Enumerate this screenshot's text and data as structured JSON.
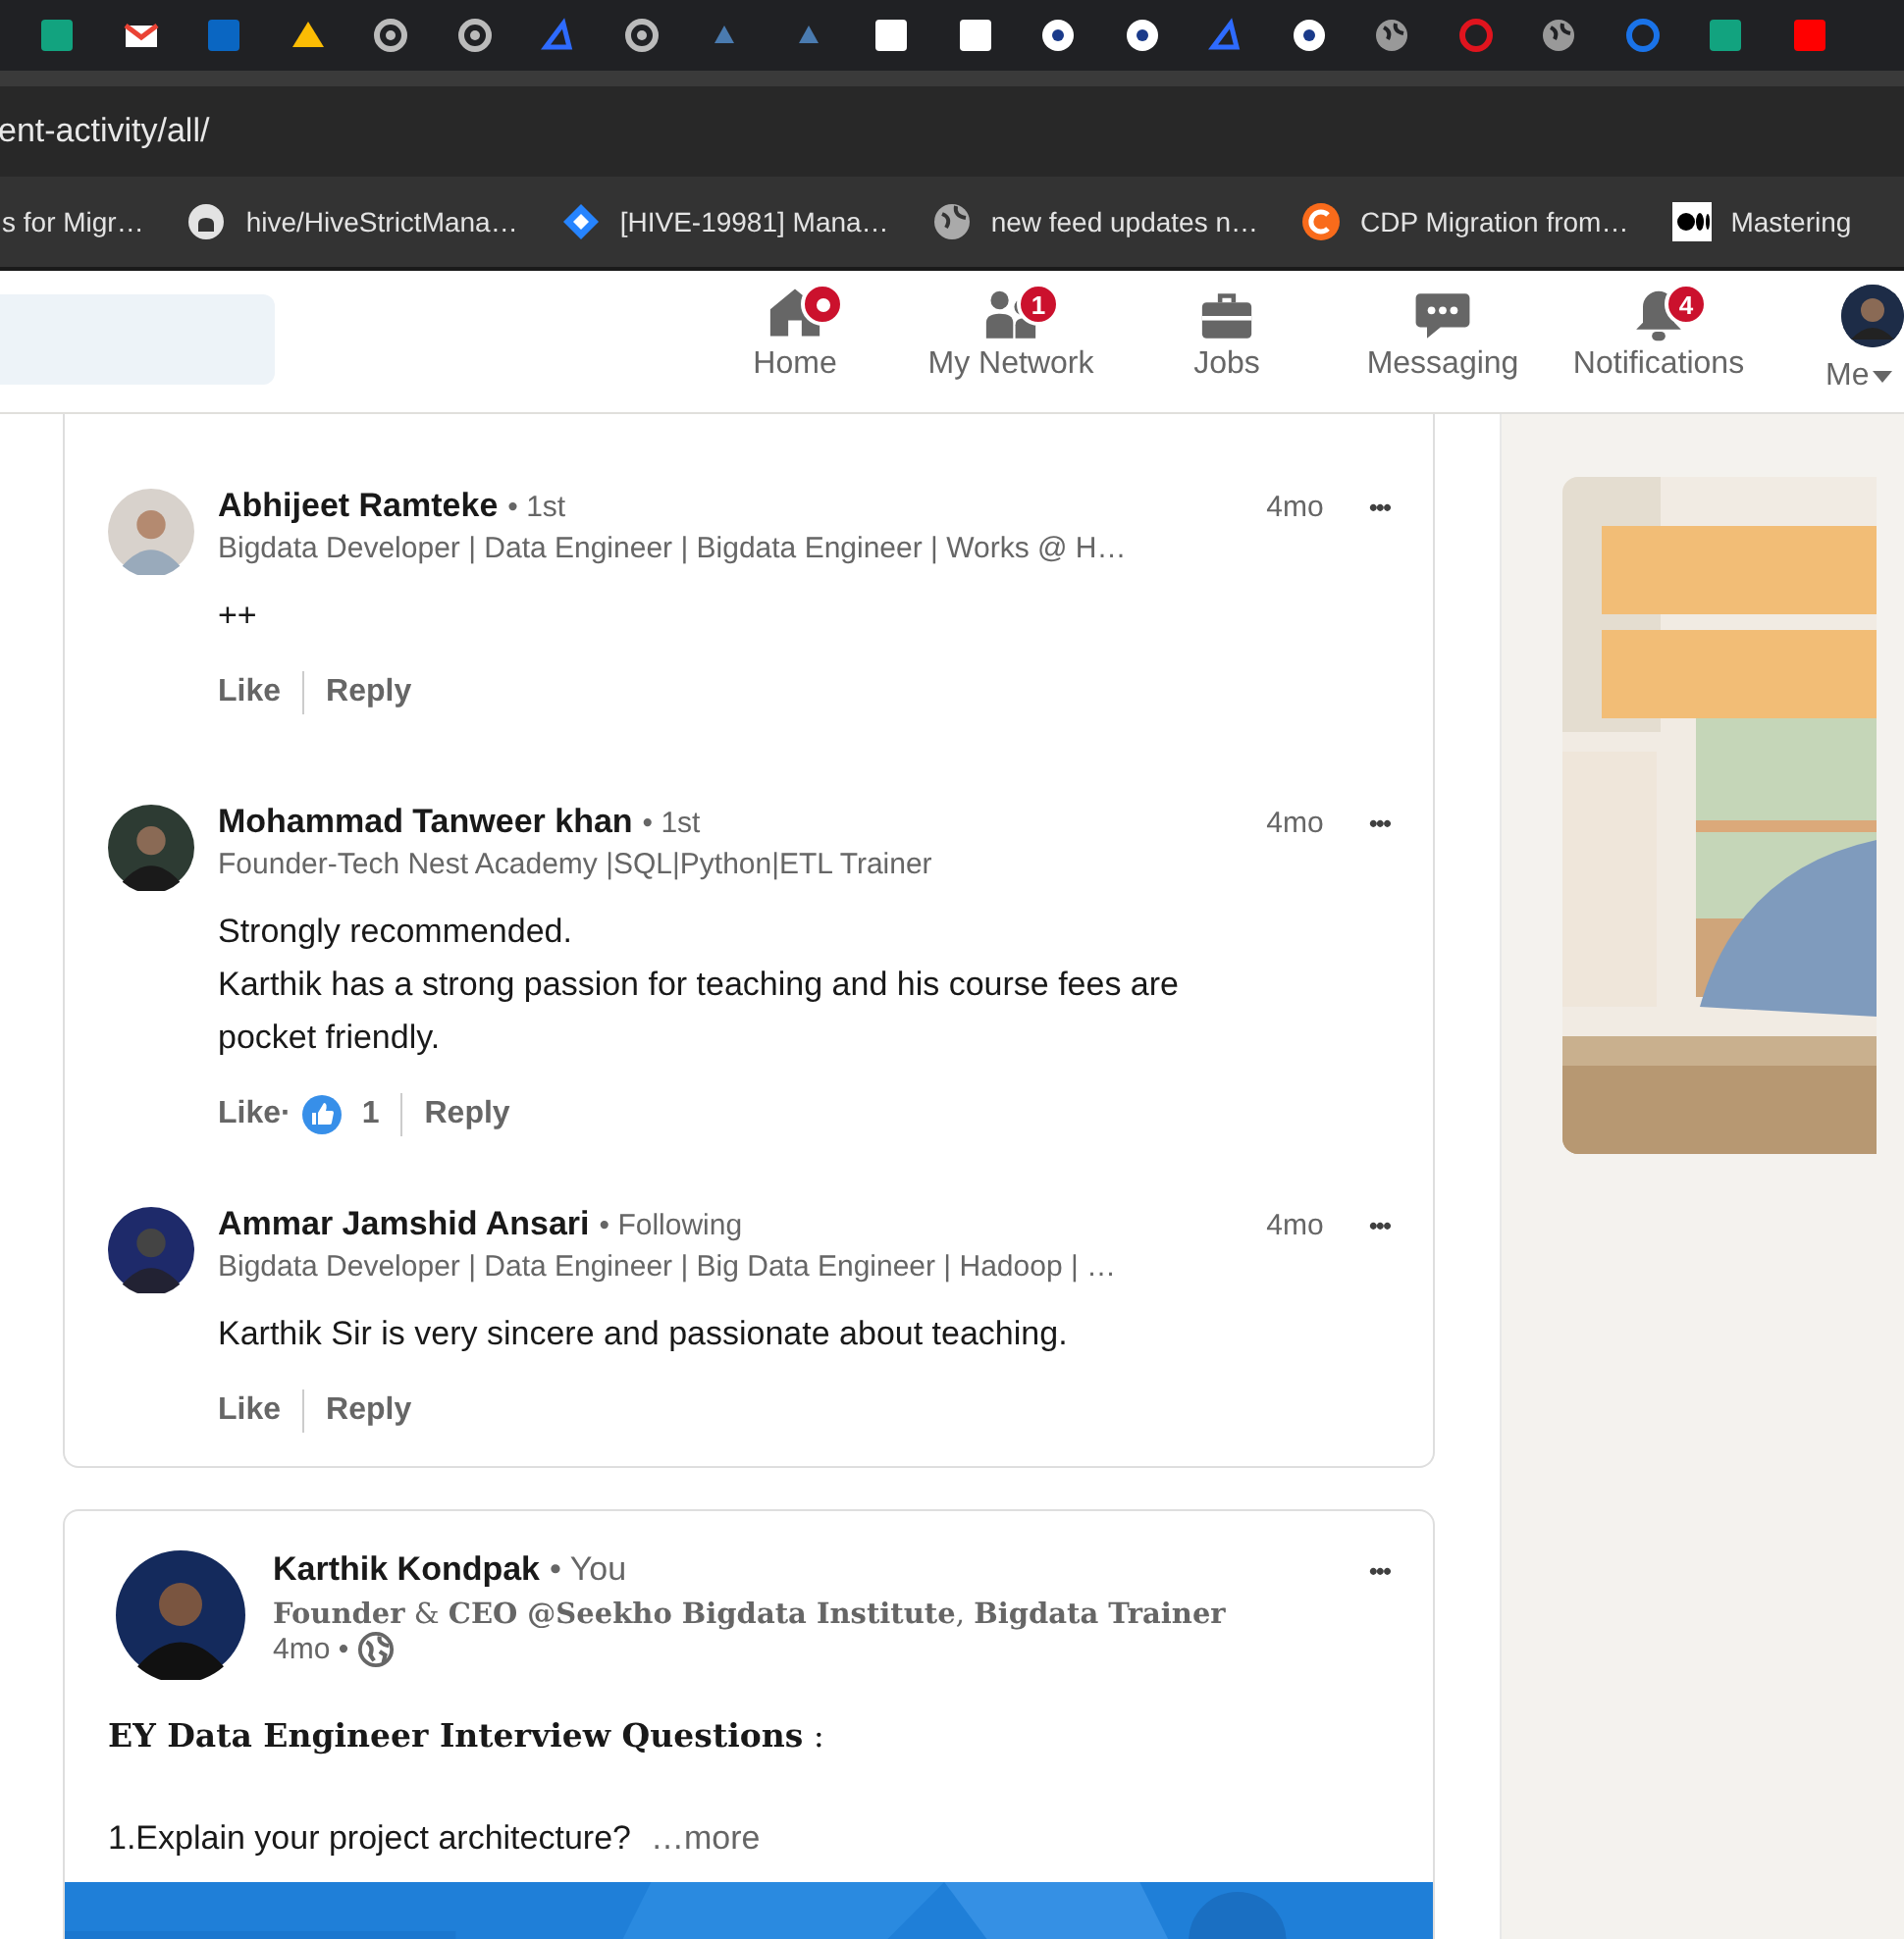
{
  "address_bar": {
    "url": "ent-activity/all/"
  },
  "bookmarks": [
    {
      "kind": "plain",
      "label": "s for Migr…"
    },
    {
      "kind": "github",
      "label": "hive/HiveStrictMana…"
    },
    {
      "kind": "diamond",
      "label": "[HIVE-19981] Mana…"
    },
    {
      "kind": "globe",
      "label": "new feed updates n…"
    },
    {
      "kind": "circle-c",
      "label": "CDP Migration from…"
    },
    {
      "kind": "medium",
      "label": "Mastering"
    }
  ],
  "nav_items": [
    {
      "kind": "home",
      "label": "Home",
      "dot": true
    },
    {
      "kind": "network",
      "label": "My Network",
      "dot": false,
      "badge": "1"
    },
    {
      "kind": "jobs",
      "label": "Jobs",
      "dot": false
    },
    {
      "kind": "messaging",
      "label": "Messaging",
      "dot": false
    },
    {
      "kind": "notifications",
      "label": "Notifications",
      "dot": false,
      "badge": "4"
    },
    {
      "kind": "me",
      "label": "Me",
      "dot": false
    }
  ],
  "comments": [
    {
      "name": "Abhijeet Ramteke",
      "relation": "• 1st",
      "headline": "Bigdata Developer | Data Engineer | Bigdata Engineer | Works @ H…",
      "time": "4mo",
      "more": "•••",
      "paragraphs": [
        "++"
      ],
      "like": "Like",
      "reply": "Reply"
    },
    {
      "name": "Mohammad Tanweer khan",
      "relation": "• 1st",
      "headline": "Founder-Tech Nest Academy |SQL|Python|ETL Trainer",
      "time": "4mo",
      "more": "•••",
      "paragraphs": [
        "Strongly recommended.",
        "Karthik has a strong passion for teaching and his course fees are pocket friendly."
      ],
      "like": "Like",
      "dot": "·",
      "reactions": "1",
      "reply": "Reply"
    },
    {
      "name": "Ammar Jamshid Ansari",
      "relation": "• Following",
      "headline": "Bigdata Developer | Data Engineer | Big Data Engineer | Hadoop | …",
      "time": "4mo",
      "more": "•••",
      "paragraphs": [
        "Karthik Sir is very sincere and passionate about teaching."
      ],
      "like": "Like",
      "reply": "Reply"
    }
  ],
  "post": {
    "author": "Karthik Kondpak",
    "relation": "• You",
    "more": "•••",
    "headline": "**Founder** & **CEO @Seekho Bigdata Institute**, **Bigdata Trainer**",
    "time": "4mo •",
    "title": "**EY Data Engineer Interview Questions** :",
    "body": "1.Explain your project architecture?",
    "see_more": "…more"
  }
}
